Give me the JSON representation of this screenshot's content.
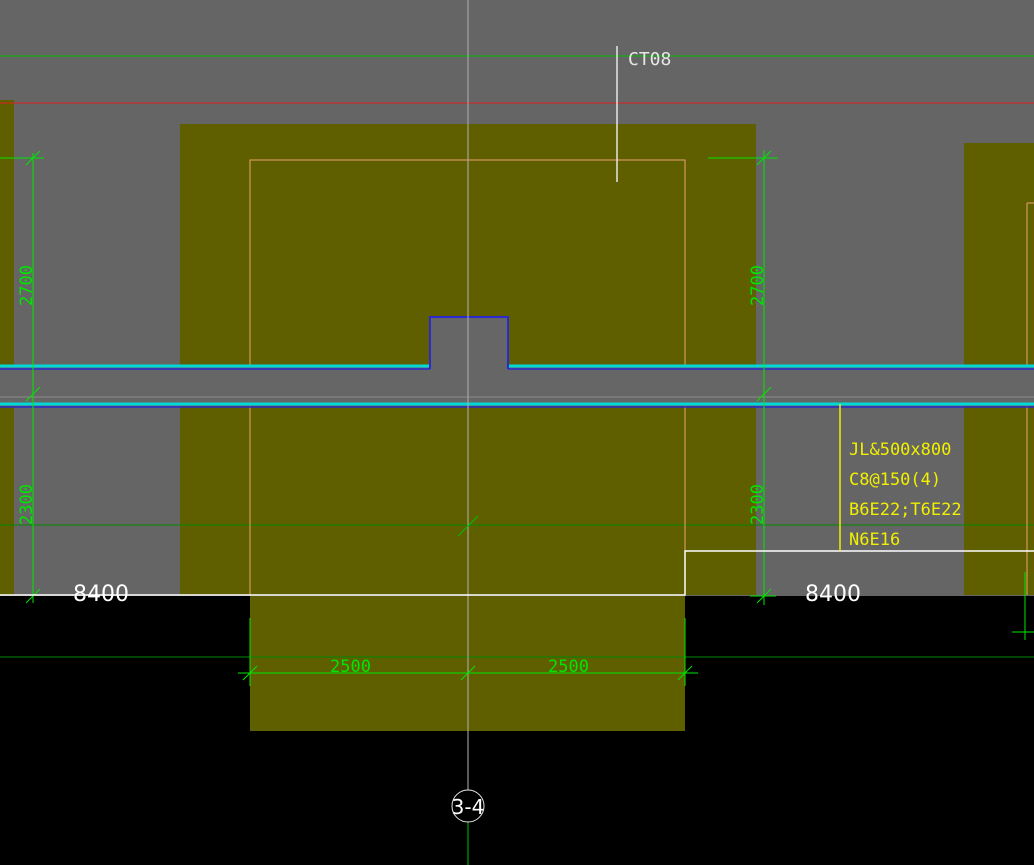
{
  "app": {
    "view": "CAD model view"
  },
  "colors": {
    "background_upper": "#656565",
    "background_lower": "#000000",
    "footing_fill": "#5f5f00",
    "axis_line": "#b0b0b0",
    "dimension": "#00e600",
    "red_line": "#e02020",
    "salmon_outline": "#e8a070",
    "beam_cyan": "#00d8d8",
    "beam_blue": "#2a2ad0",
    "annotation_yellow": "#f0f000",
    "white": "#ffffff"
  },
  "labels": {
    "cap_tag": "CT08",
    "left_dim_upper": "2700",
    "left_dim_lower": "2300",
    "right_dim_upper": "2700",
    "right_dim_lower": "2300",
    "span_left": "8400",
    "span_right": "8400",
    "bottom_dim_left": "2500",
    "bottom_dim_right": "2500",
    "axis_bubble": "3-4"
  },
  "beam_annotation": {
    "line1": "JL&500x800",
    "line2": "C8@150(4)",
    "line3": "B6E22;T6E22",
    "line4": "N6E16"
  }
}
